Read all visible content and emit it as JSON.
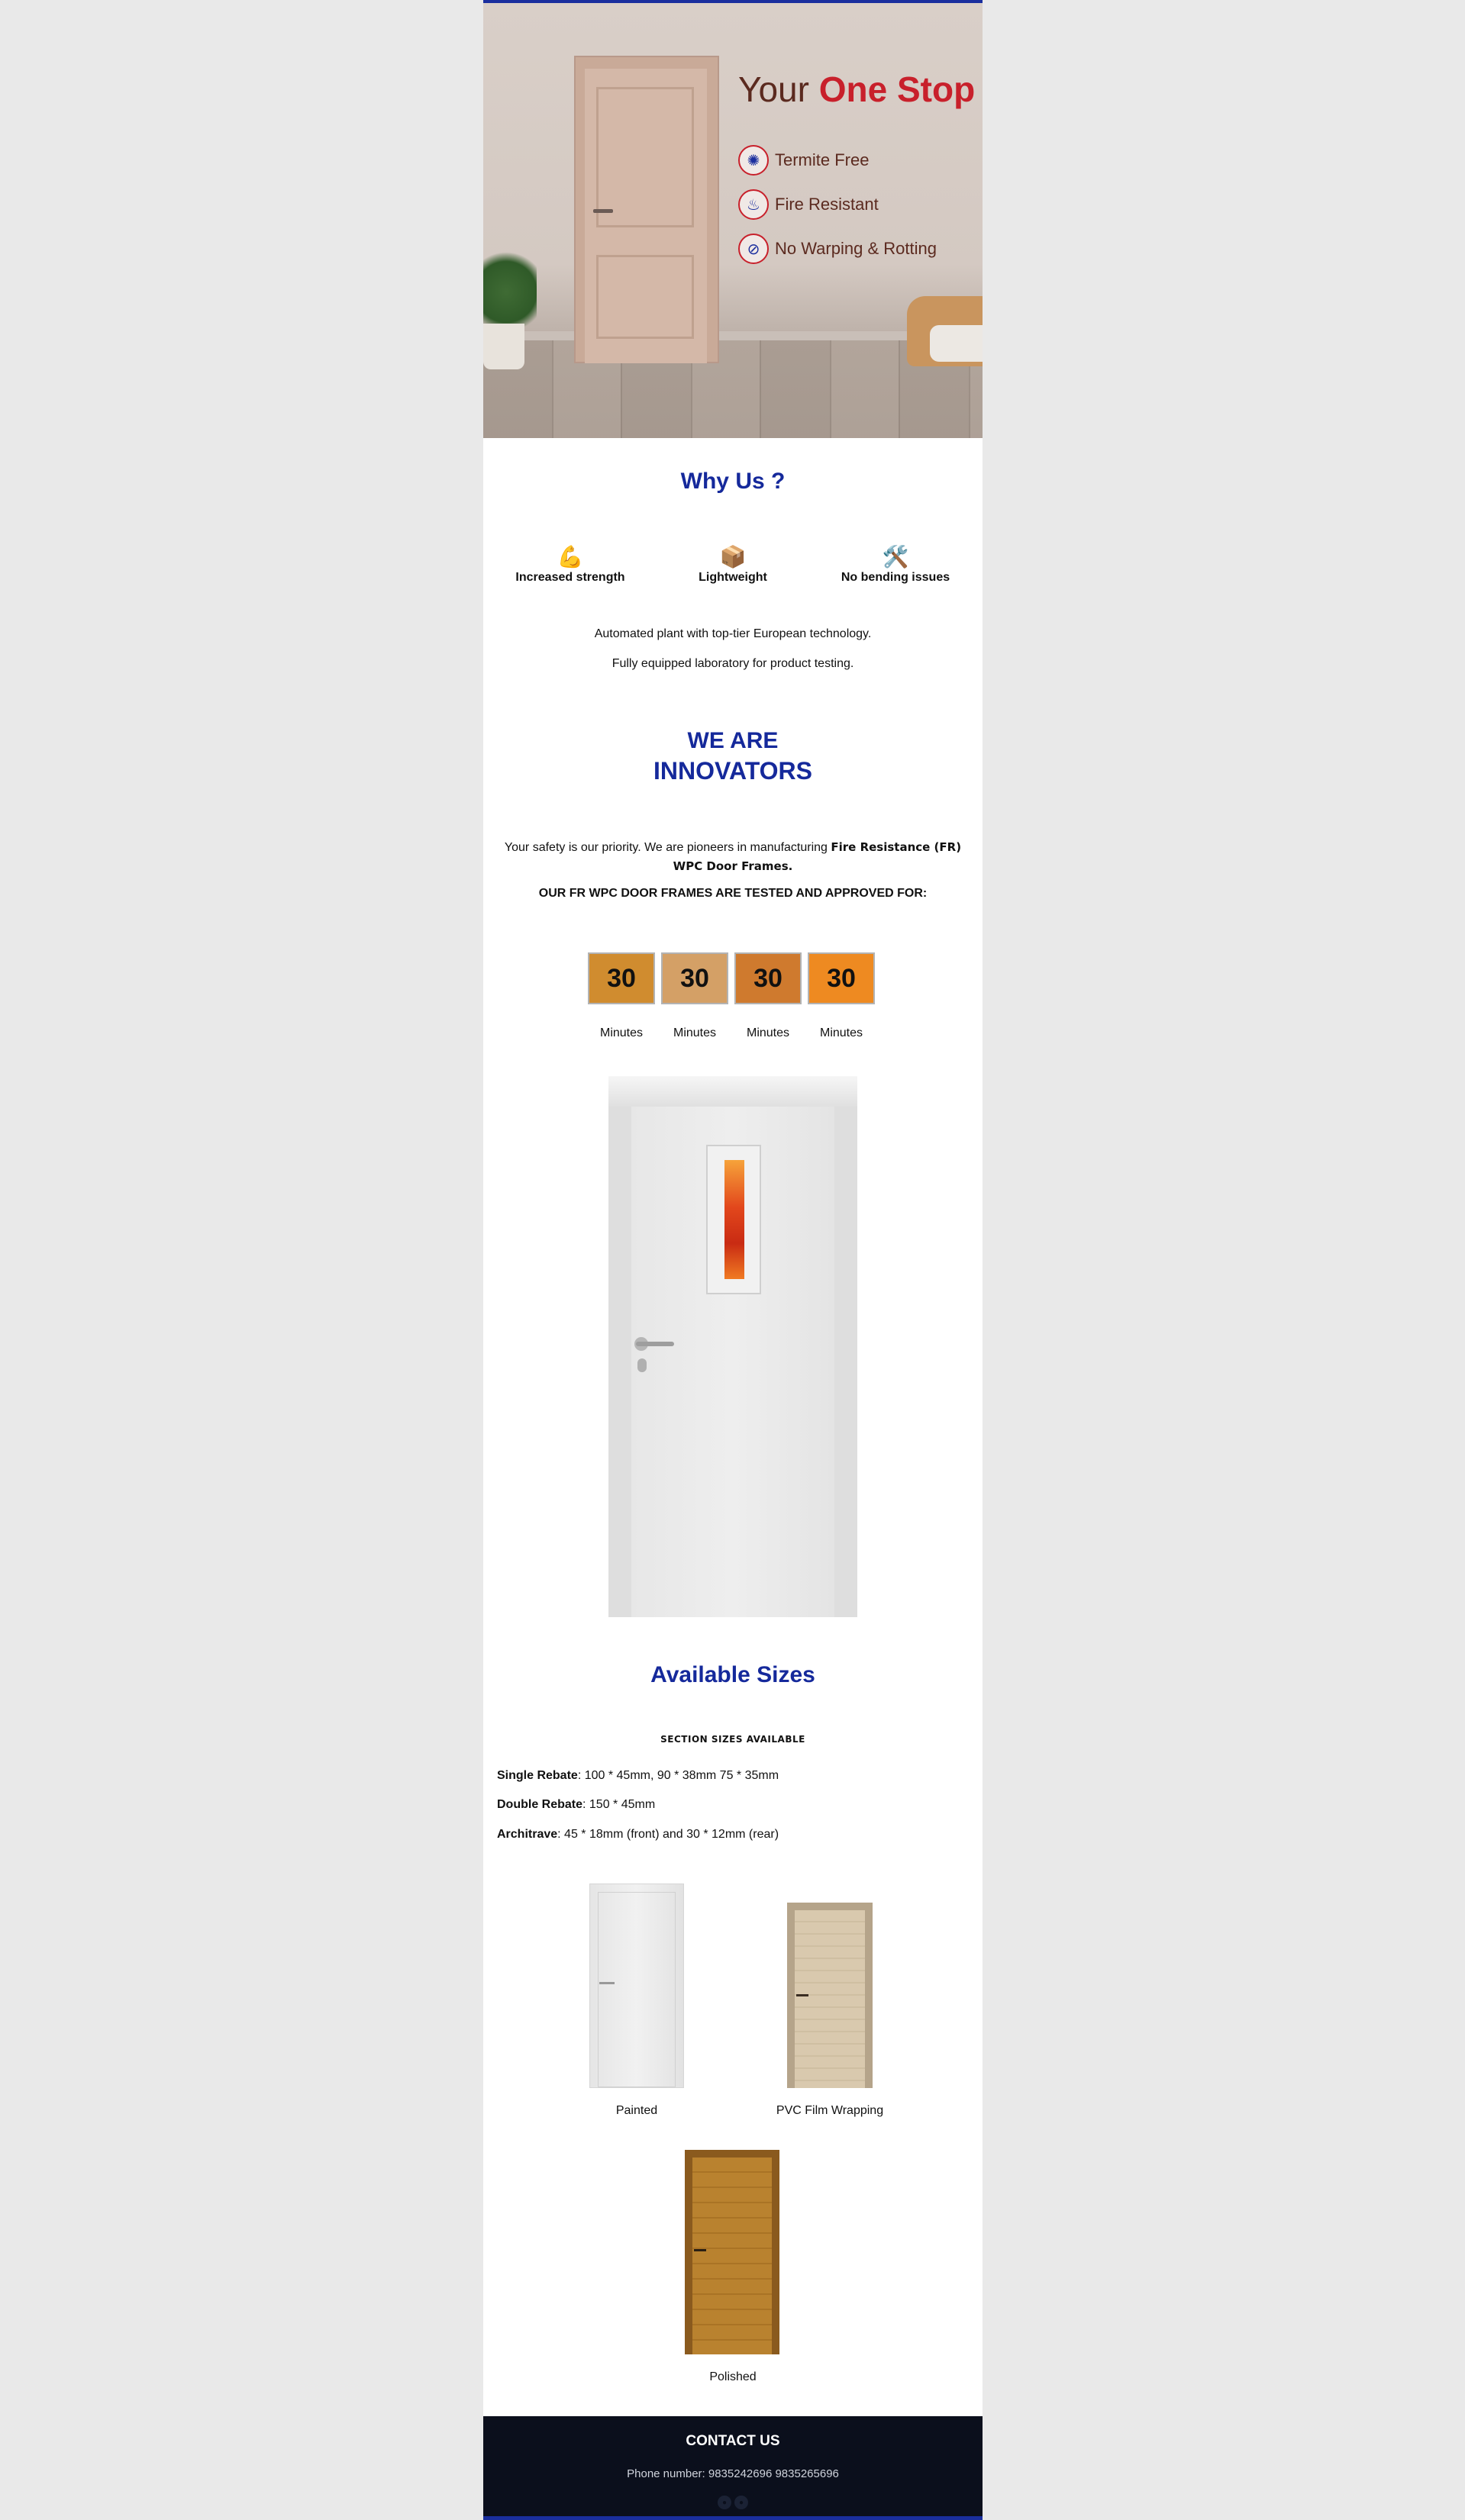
{
  "hero": {
    "headline_prefix": "Your ",
    "headline_accent": "One Stop",
    "features": [
      {
        "icon": "termite-icon",
        "label": "Termite Free"
      },
      {
        "icon": "fire-icon",
        "label": "Fire Resistant"
      },
      {
        "icon": "no-warping-icon",
        "label": "No Warping & Rotting"
      }
    ]
  },
  "why_us": {
    "title": "Why Us ?",
    "items": [
      {
        "emoji": "💪",
        "icon": "flexed-bicep-icon",
        "label": "Increased strength"
      },
      {
        "emoji": "📦",
        "icon": "package-icon",
        "label": "Lightweight"
      },
      {
        "emoji": "🛠️",
        "icon": "tools-icon",
        "label": "No bending issues"
      }
    ],
    "line1": "Automated plant with top-tier European technology.",
    "line2": "Fully equipped laboratory for product testing."
  },
  "innovators": {
    "title_line1": "WE ARE",
    "title_line2": "INNOVATORS",
    "safety_text": "Your safety is our priority. We are pioneers in manufacturing ",
    "safety_bold": "Fire Resistance (FR) WPC Door Frames.",
    "approved": "OUR FR WPC DOOR FRAMES ARE TESTED AND APPROVED FOR:",
    "ratings": [
      {
        "value": "30",
        "unit": "Minutes",
        "color": "#d08c2f"
      },
      {
        "value": "30",
        "unit": "Minutes",
        "color": "#d4a066"
      },
      {
        "value": "30",
        "unit": "Minutes",
        "color": "#cf7a2e"
      },
      {
        "value": "30",
        "unit": "Minutes",
        "color": "#ee8a21"
      }
    ]
  },
  "sizes": {
    "title": "Available Sizes",
    "subheading": "SECTION SIZES AVAILABLE",
    "specs": [
      {
        "name": "Single Rebate",
        "value": ": 100 * 45mm, 90 * 38mm 75 * 35mm"
      },
      {
        "name": "Double Rebate",
        "value": ": 150 * 45mm"
      },
      {
        "name": "Architrave",
        "value": ": 45 * 18mm (front) and 30 * 12mm (rear)"
      }
    ],
    "finishes": [
      "Painted",
      "PVC Film Wrapping",
      "Polished"
    ]
  },
  "footer": {
    "title": "CONTACT US",
    "phone": "Phone number: 9835242696 9835265696"
  },
  "colors": {
    "brand_blue": "#15299b",
    "accent_red": "#c8202b",
    "footer_bg": "#0b0f1c"
  }
}
